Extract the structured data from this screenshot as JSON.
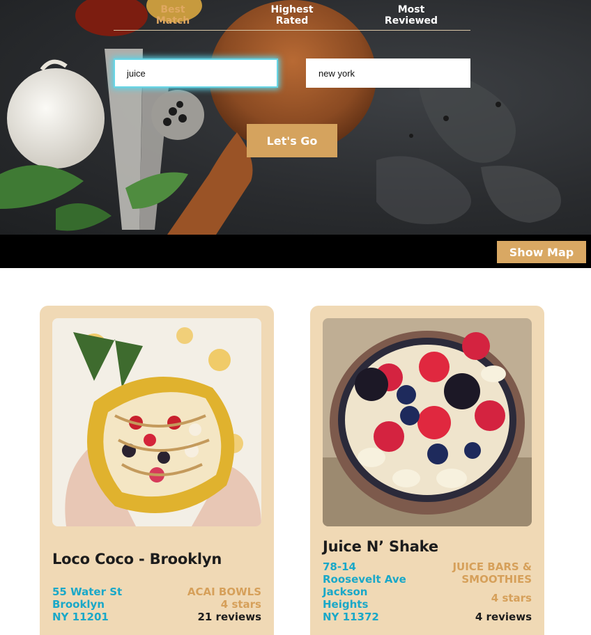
{
  "sort_tabs": [
    {
      "line1": "Best",
      "line2": "Match"
    },
    {
      "line1": "Highest",
      "line2": "Rated"
    },
    {
      "line1": "Most",
      "line2": "Reviewed"
    }
  ],
  "search": {
    "term_value": "juice",
    "location_value": "new york",
    "submit_label": "Let's Go"
  },
  "toolbar": {
    "show_map_label": "Show Map"
  },
  "results": [
    {
      "name": "Loco Coco - Brooklyn",
      "address": [
        "55 Water St",
        "Brooklyn",
        "NY 11201"
      ],
      "category": [
        "ACAI BOWLS"
      ],
      "stars": "4 stars",
      "reviews": "21 reviews"
    },
    {
      "name": "Juice N’ Shake",
      "address": [
        "78-14",
        "Roosevelt Ave",
        "Jackson",
        "Heights",
        "NY 11372"
      ],
      "category": [
        "JUICE BARS &",
        "SMOOTHIES"
      ],
      "stars": "4 stars",
      "reviews": "4 reviews"
    }
  ],
  "colors": {
    "accent": "#d5a35e",
    "card_bg": "#f0d9b5",
    "address": "#1aa8c8",
    "focus_glow": "#5cd4e8"
  }
}
